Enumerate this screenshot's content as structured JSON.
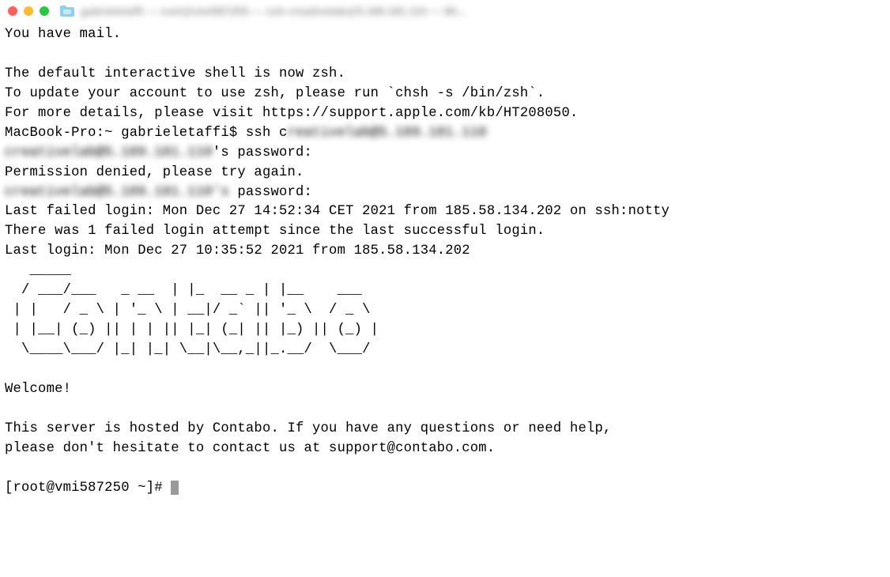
{
  "titlebar": {
    "blurred_title": "gabrieletaffi — root@vmi587250 — ssh creativelab@5.189.181.110 — 80..."
  },
  "terminal": {
    "mail_notice": "You have mail.",
    "zsh_notice_1": "The default interactive shell is now zsh.",
    "zsh_notice_2": "To update your account to use zsh, please run `chsh -s /bin/zsh`.",
    "zsh_notice_3": "For more details, please visit https://support.apple.com/kb/HT208050.",
    "local_prompt": "MacBook-Pro:~ gabrieletaffi$ ssh c",
    "ssh_target_blur": "reativelab@5.189.181.110",
    "pw_host_blur_1": "creativelab@5.189.181.110",
    "pw_suffix_1": "'s password:",
    "perm_denied": "Permission denied, please try again.",
    "pw_host_blur_2": "creativelab@5.189.181.110's",
    "pw_suffix_2": " password:",
    "last_failed": "Last failed login: Mon Dec 27 14:52:34 CET 2021 from 185.58.134.202 on ssh:notty",
    "failed_count": "There was 1 failed login attempt since the last successful login.",
    "last_login": "Last login: Mon Dec 27 10:35:52 2021 from 185.58.134.202",
    "ascii_1": "   _____",
    "ascii_2": "  / ___/___   _ __  | |_  __ _ | |__    ___",
    "ascii_3": " | |   / _ \\ | '_ \\ | __|/ _` || '_ \\  / _ \\",
    "ascii_4": " | |__| (_) || | | || |_| (_| || |_) || (_) |",
    "ascii_5": "  \\____\\___/ |_| |_| \\__|\\__,_||_.__/  \\___/",
    "welcome": "Welcome!",
    "hosted_1": "This server is hosted by Contabo. If you have any questions or need help,",
    "hosted_2": "please don't hesitate to contact us at support@contabo.com.",
    "remote_prompt": "[root@vmi587250 ~]# "
  }
}
